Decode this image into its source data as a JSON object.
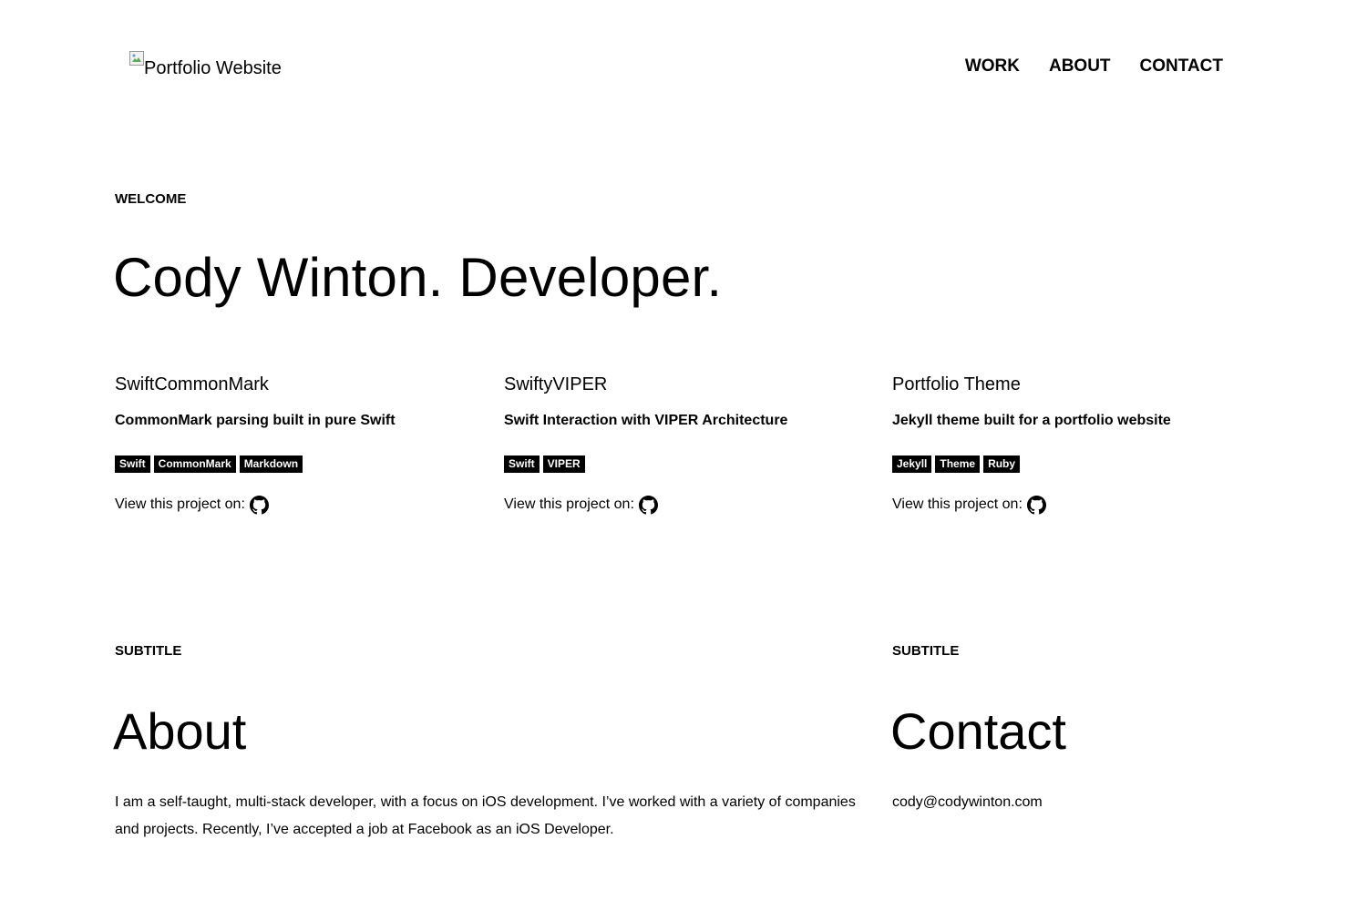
{
  "header": {
    "logo_alt": "Portfolio Website",
    "nav": [
      {
        "label": "WORK"
      },
      {
        "label": "ABOUT"
      },
      {
        "label": "CONTACT"
      }
    ]
  },
  "hero": {
    "eyebrow": "WELCOME",
    "title": "Cody Winton. Developer."
  },
  "projects": [
    {
      "name": "SwiftCommonMark",
      "description": "CommonMark parsing built in pure Swift",
      "tags": [
        "Swift",
        "CommonMark",
        "Markdown"
      ],
      "view_label": "View this project on:",
      "icon": "github-icon"
    },
    {
      "name": "SwiftyVIPER",
      "description": "Swift Interaction with VIPER Architecture",
      "tags": [
        "Swift",
        "VIPER"
      ],
      "view_label": "View this project on:",
      "icon": "github-icon"
    },
    {
      "name": "Portfolio Theme",
      "description": "Jekyll theme built for a portfolio website",
      "tags": [
        "Jekyll",
        "Theme",
        "Ruby"
      ],
      "view_label": "View this project on:",
      "icon": "github-icon"
    }
  ],
  "about": {
    "eyebrow": "SUBTITLE",
    "title": "About",
    "text": "I am a self-taught, multi-stack developer, with a focus on iOS development. I’ve worked with a variety of companies and projects. Recently, I’ve accepted a job at Facebook as an iOS Developer."
  },
  "contact": {
    "eyebrow": "SUBTITLE",
    "title": "Contact",
    "email": "cody@codywinton.com"
  },
  "colors": {
    "text": "#000000",
    "background": "#ffffff",
    "tag_background": "#000000",
    "tag_text": "#ffffff"
  }
}
